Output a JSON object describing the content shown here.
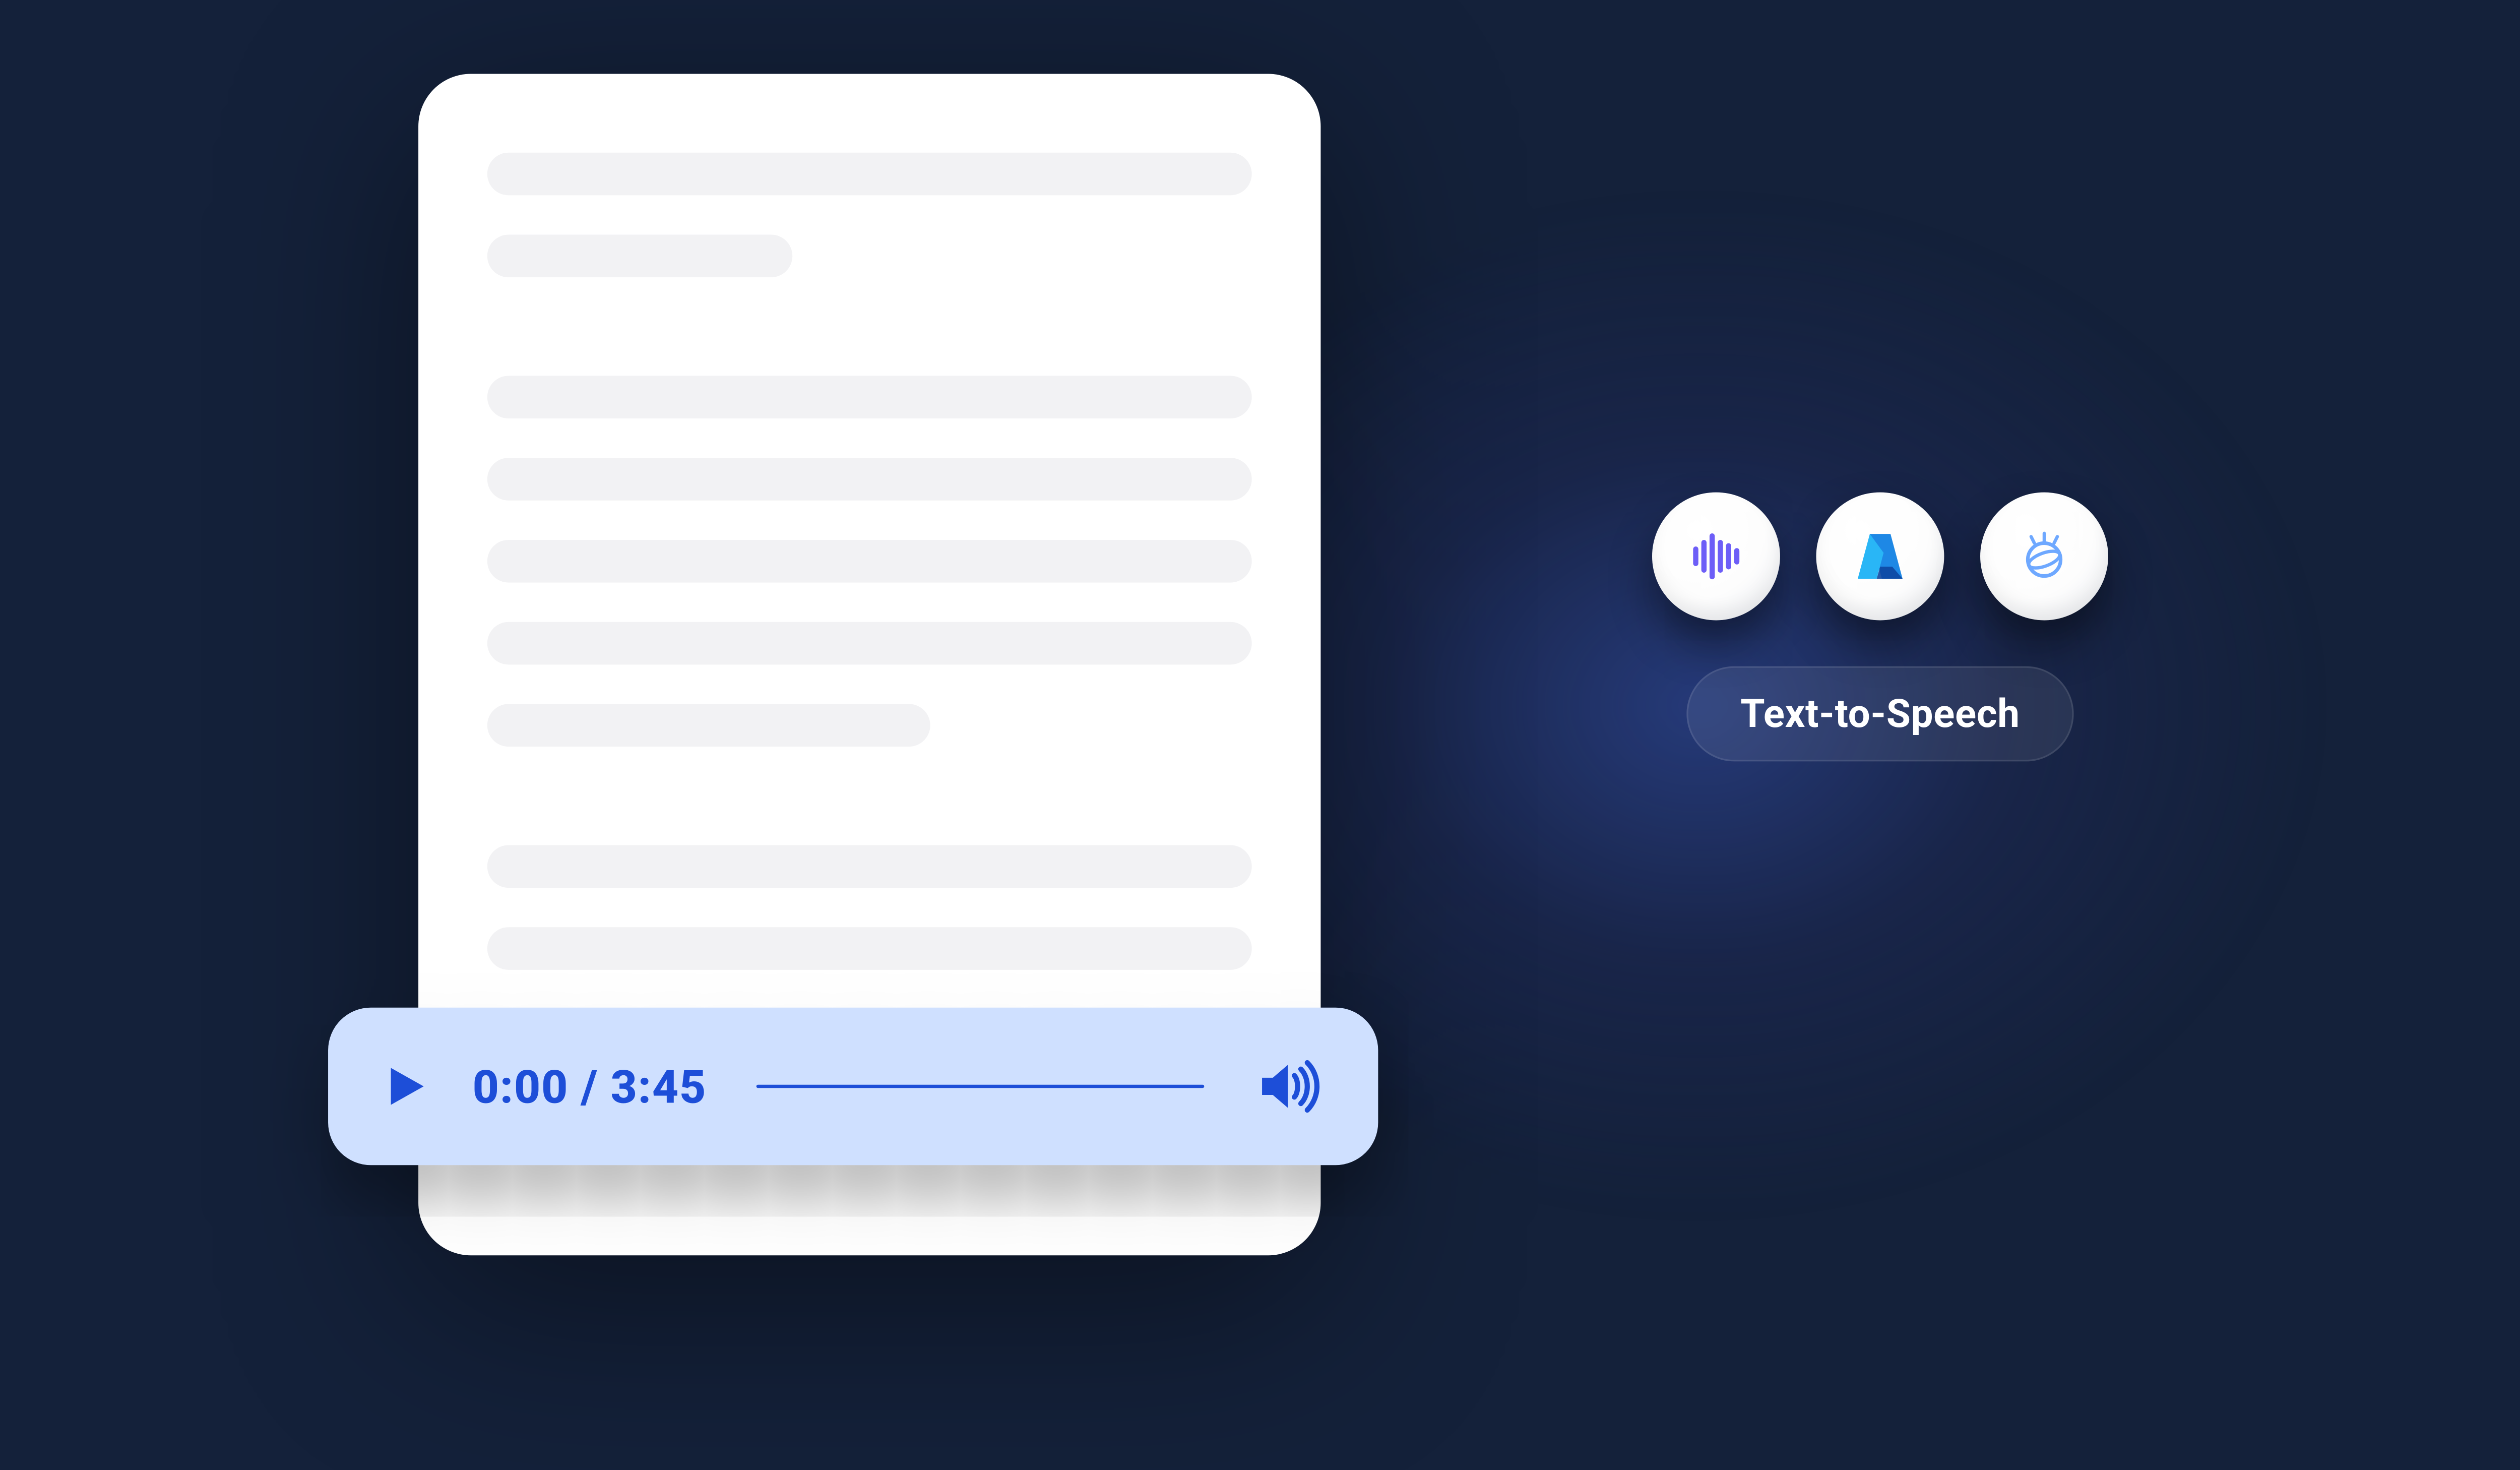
{
  "audio_player": {
    "current_time": "0:00",
    "duration": "3:45",
    "separator": " / "
  },
  "tts": {
    "label": "Text-to-Speech",
    "services": [
      {
        "name": "waveform-service",
        "icon": "waveform-icon"
      },
      {
        "name": "azure",
        "icon": "azure-icon"
      },
      {
        "name": "ibm-watson",
        "icon": "watson-icon"
      }
    ]
  },
  "colors": {
    "bg": "#14213a",
    "player_bg": "#cfe0ff",
    "accent": "#1d4ed8"
  }
}
